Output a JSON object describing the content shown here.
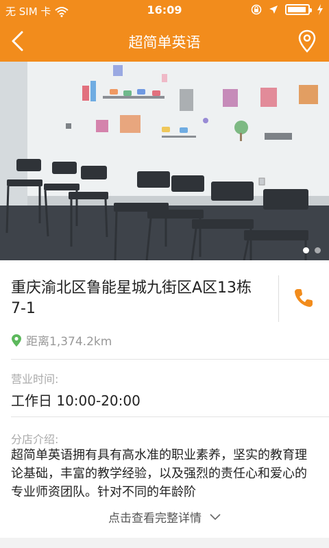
{
  "status_bar": {
    "carrier": "无 SIM 卡",
    "time": "16:09"
  },
  "nav": {
    "title": "超简单英语"
  },
  "colors": {
    "brand": "#f28c1c",
    "location_green": "#5cb85c",
    "phone_orange": "#f28c1c"
  },
  "banner": {
    "slide_count": 2,
    "active_slide": 1
  },
  "store": {
    "address": "重庆渝北区鲁能星城九街区A区13栋7-1",
    "distance": "距离1,374.2km"
  },
  "hours": {
    "label": "营业时间:",
    "value": "工作日 10:00-20:00"
  },
  "intro": {
    "label": "分店介绍:",
    "text": "超简单英语拥有具有高水准的职业素养，坚实的教育理论基础，丰富的教学经验，以及强烈的责任心和爱心的专业师资团队。针对不同的年龄阶",
    "more_label": "点击查看完整详情"
  }
}
